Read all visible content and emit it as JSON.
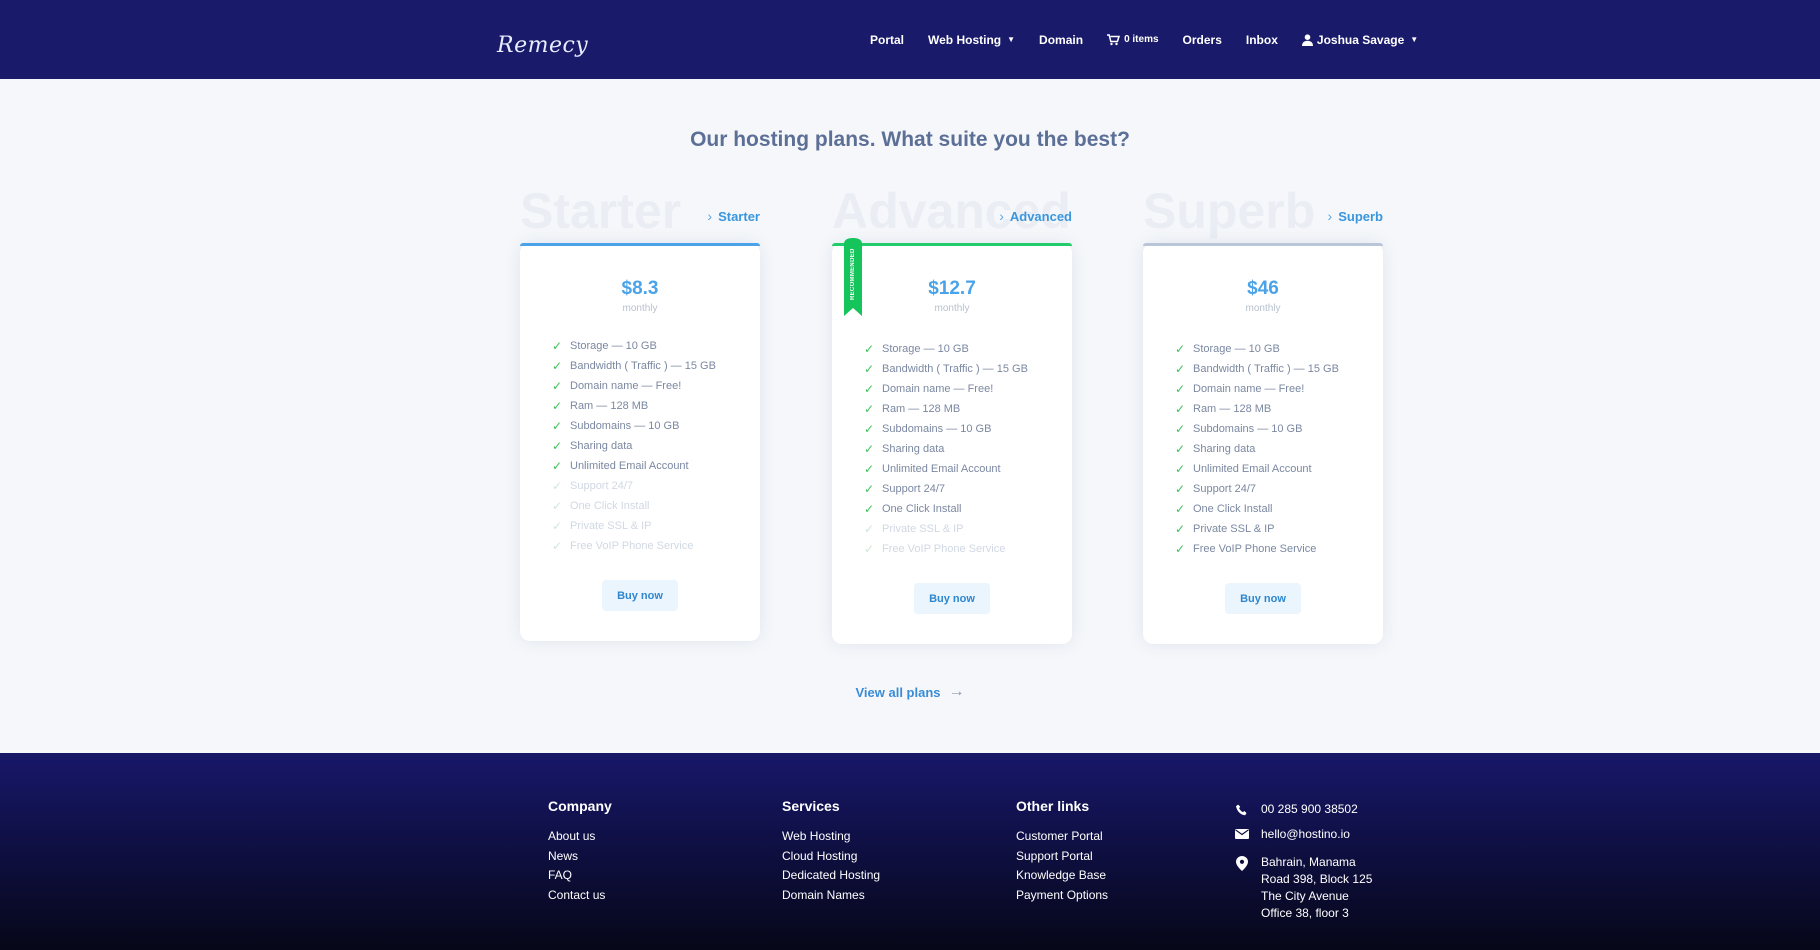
{
  "brand": {
    "logo_text": "Remecy"
  },
  "nav": {
    "items": [
      {
        "label": "Portal"
      },
      {
        "label": "Web Hosting"
      },
      {
        "label": "Domain"
      },
      {
        "label": "0 items",
        "icon": "cart-icon"
      },
      {
        "label": "Orders"
      },
      {
        "label": "Inbox"
      },
      {
        "label": "Joshua Savage",
        "icon": "user-icon"
      }
    ]
  },
  "main": {
    "heading": "Our hosting plans. What suite you the best?",
    "view_all": "View all plans"
  },
  "plans": [
    {
      "ghost": "Starter",
      "link": "Starter",
      "price": "$8.3",
      "period": "monthly",
      "button": "Buy now",
      "accent": "#4aa3e8",
      "features": [
        {
          "text": "Storage — 10 GB",
          "on": true
        },
        {
          "text": "Bandwidth ( Traffic ) — 15 GB",
          "on": true
        },
        {
          "text": "Domain name — Free!",
          "on": true
        },
        {
          "text": "Ram — 128 MB",
          "on": true
        },
        {
          "text": "Subdomains — 10 GB",
          "on": true
        },
        {
          "text": "Sharing data",
          "on": true
        },
        {
          "text": "Unlimited Email Account",
          "on": true
        },
        {
          "text": "Support 24/7",
          "on": false
        },
        {
          "text": "One Click Install",
          "on": false
        },
        {
          "text": "Private SSL & IP",
          "on": false
        },
        {
          "text": "Free VoIP Phone Service",
          "on": false
        }
      ]
    },
    {
      "ghost": "Advanced",
      "link": "Advanced",
      "price": "$12.7",
      "period": "monthly",
      "button": "Buy now",
      "accent": "#22cc6b",
      "ribbon": "RECOMMENDED",
      "features": [
        {
          "text": "Storage — 10 GB",
          "on": true
        },
        {
          "text": "Bandwidth ( Traffic ) — 15 GB",
          "on": true
        },
        {
          "text": "Domain name — Free!",
          "on": true
        },
        {
          "text": "Ram — 128 MB",
          "on": true
        },
        {
          "text": "Subdomains — 10 GB",
          "on": true
        },
        {
          "text": "Sharing data",
          "on": true
        },
        {
          "text": "Unlimited Email Account",
          "on": true
        },
        {
          "text": "Support 24/7",
          "on": true
        },
        {
          "text": "One Click Install",
          "on": true
        },
        {
          "text": "Private SSL & IP",
          "on": false
        },
        {
          "text": "Free VoIP Phone Service",
          "on": false
        }
      ]
    },
    {
      "ghost": "Superb",
      "link": "Superb",
      "price": "$46",
      "period": "monthly",
      "button": "Buy now",
      "accent": "#b9c6d8",
      "features": [
        {
          "text": "Storage — 10 GB",
          "on": true
        },
        {
          "text": "Bandwidth ( Traffic ) — 15 GB",
          "on": true
        },
        {
          "text": "Domain name — Free!",
          "on": true
        },
        {
          "text": "Ram — 128 MB",
          "on": true
        },
        {
          "text": "Subdomains — 10 GB",
          "on": true
        },
        {
          "text": "Sharing data",
          "on": true
        },
        {
          "text": "Unlimited Email Account",
          "on": true
        },
        {
          "text": "Support 24/7",
          "on": true
        },
        {
          "text": "One Click Install",
          "on": true
        },
        {
          "text": "Private SSL & IP",
          "on": true
        },
        {
          "text": "Free VoIP Phone Service",
          "on": true
        }
      ]
    }
  ],
  "footer": {
    "columns": [
      {
        "title": "Company",
        "links": [
          "About us",
          "News",
          "FAQ",
          "Contact us"
        ]
      },
      {
        "title": "Services",
        "links": [
          "Web Hosting",
          "Cloud Hosting",
          "Dedicated Hosting",
          "Domain Names"
        ]
      },
      {
        "title": "Other links",
        "links": [
          "Customer Portal",
          "Support Portal",
          "Knowledge Base",
          "Payment Options"
        ]
      }
    ],
    "contact": {
      "phone": "00 285 900 38502",
      "email": "hello@hostino.io",
      "address": [
        "Bahrain, Manama",
        "Road 398, Block 125",
        "The City Avenue",
        "Office 38, floor 3"
      ]
    }
  }
}
